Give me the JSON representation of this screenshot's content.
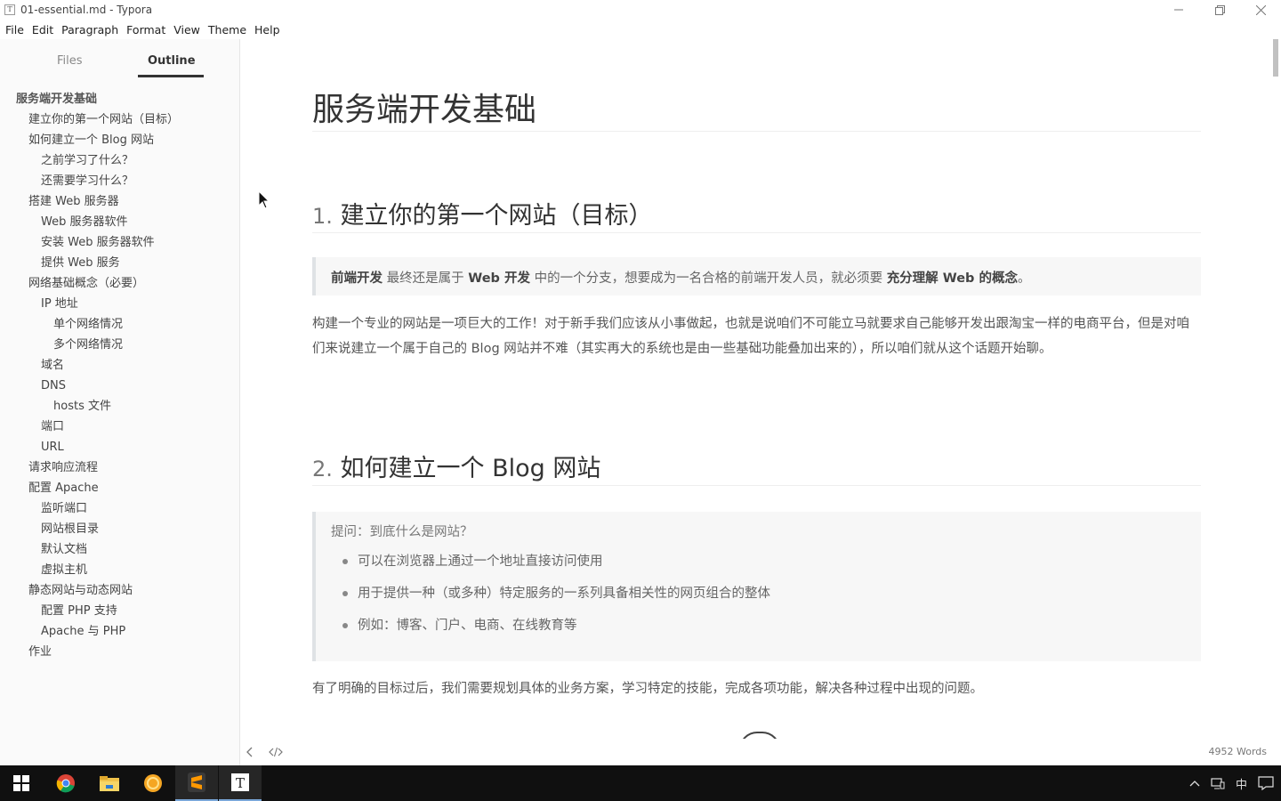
{
  "window": {
    "app_icon": "T",
    "title": "01-essential.md - Typora"
  },
  "menu": [
    "File",
    "Edit",
    "Paragraph",
    "Format",
    "View",
    "Theme",
    "Help"
  ],
  "sidebar": {
    "tabs": [
      "Files",
      "Outline"
    ],
    "active_tab": "Outline",
    "outline": [
      {
        "level": 1,
        "label": "服务端开发基础"
      },
      {
        "level": 2,
        "label": "建立你的第一个网站（目标）"
      },
      {
        "level": 2,
        "label": "如何建立一个 Blog 网站"
      },
      {
        "level": 3,
        "label": "之前学习了什么？"
      },
      {
        "level": 3,
        "label": "还需要学习什么？"
      },
      {
        "level": 2,
        "label": "搭建 Web 服务器"
      },
      {
        "level": 3,
        "label": "Web 服务器软件"
      },
      {
        "level": 3,
        "label": "安装 Web 服务器软件"
      },
      {
        "level": 3,
        "label": "提供 Web 服务"
      },
      {
        "level": 2,
        "label": "网络基础概念（必要）"
      },
      {
        "level": 3,
        "label": "IP 地址"
      },
      {
        "level": 4,
        "label": "单个网络情况"
      },
      {
        "level": 4,
        "label": "多个网络情况"
      },
      {
        "level": 3,
        "label": "域名"
      },
      {
        "level": 3,
        "label": "DNS"
      },
      {
        "level": 4,
        "label": "hosts 文件"
      },
      {
        "level": 3,
        "label": "端口"
      },
      {
        "level": 3,
        "label": "URL"
      },
      {
        "level": 2,
        "label": "请求响应流程"
      },
      {
        "level": 2,
        "label": "配置 Apache"
      },
      {
        "level": 3,
        "label": "监听端口"
      },
      {
        "level": 3,
        "label": "网站根目录"
      },
      {
        "level": 3,
        "label": "默认文档"
      },
      {
        "level": 3,
        "label": "虚拟主机"
      },
      {
        "level": 2,
        "label": "静态网站与动态网站"
      },
      {
        "level": 3,
        "label": "配置 PHP 支持"
      },
      {
        "level": 3,
        "label": "Apache 与 PHP"
      },
      {
        "level": 2,
        "label": "作业"
      }
    ]
  },
  "document": {
    "h1": "服务端开发基础",
    "section1": {
      "num": "1.",
      "title": "建立你的第一个网站（目标）",
      "quote": {
        "b1": "前端开发",
        "t1": " 最终还是属于 ",
        "b2": "Web 开发",
        "t2": " 中的一个分支，想要成为一名合格的前端开发人员，就必须要 ",
        "b3": "充分理解 Web 的概念",
        "t3": "。"
      },
      "paragraph": "构建一个专业的网站是一项巨大的工作！对于新手我们应该从小事做起，也就是说咱们不可能立马就要求自己能够开发出跟淘宝一样的电商平台，但是对咱们来说建立一个属于自己的 Blog 网站并不难（其实再大的系统也是由一些基础功能叠加出来的），所以咱们就从这个话题开始聊。"
    },
    "section2": {
      "num": "2.",
      "title": "如何建立一个 Blog 网站",
      "question": "提问：到底什么是网站？",
      "bullets": [
        "可以在浏览器上通过一个地址直接访问使用",
        "用于提供一种（或多种）特定服务的一系列具备相关性的网页组合的整体",
        "例如：博客、门户、电商、在线教育等"
      ],
      "paragraph": "有了明确的目标过后，我们需要规划具体的业务方案，学习特定的技能，完成各项功能，解决各种过程中出现的问题。"
    }
  },
  "status": {
    "word_count": "4952 Words"
  },
  "taskbar": {
    "icons": [
      "windows-start-icon",
      "chrome-icon",
      "file-explorer-icon",
      "browser-yellow-icon",
      "sublime-text-icon",
      "typora-icon"
    ],
    "tray_ime": "中"
  }
}
